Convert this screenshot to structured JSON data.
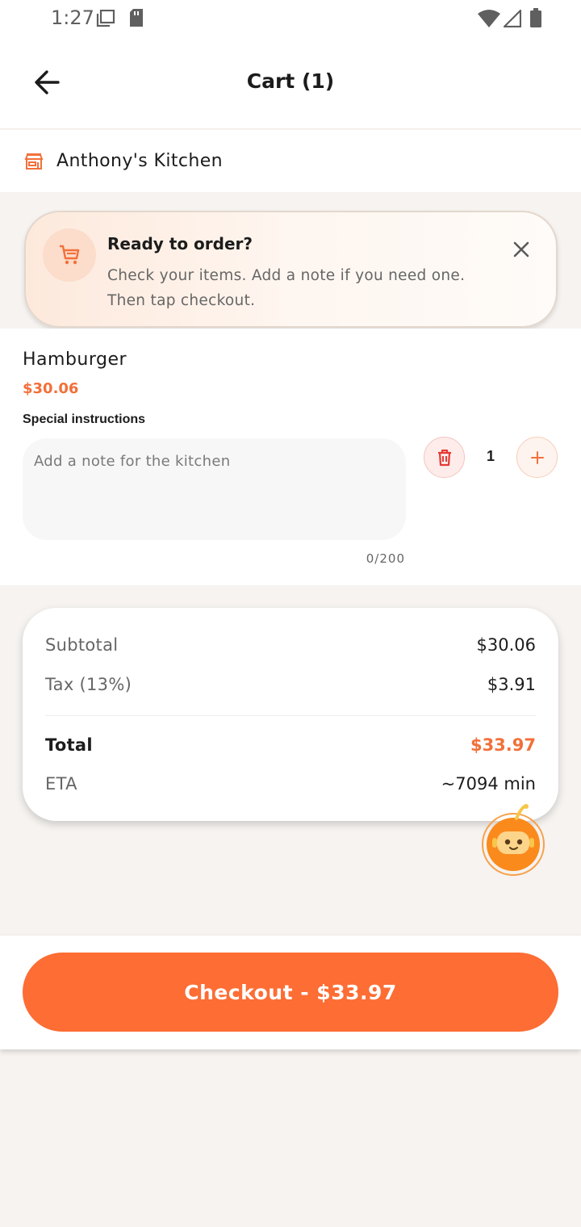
{
  "status_bar": {
    "time": "1:27"
  },
  "app_bar": {
    "title": "Cart (1)"
  },
  "restaurant": {
    "name": "Anthony's Kitchen"
  },
  "hint": {
    "title": "Ready to order?",
    "body": "Check your items. Add a note if you need one. Then tap checkout."
  },
  "item": {
    "name": "Hamburger",
    "price": "$30.06",
    "instructions_label": "Special instructions",
    "note_placeholder": "Add a note for the kitchen",
    "note_value": "",
    "char_count": "0/200",
    "quantity": "1"
  },
  "summary": {
    "subtotal_label": "Subtotal",
    "subtotal_value": "$30.06",
    "tax_label": "Tax (13%)",
    "tax_value": "$3.91",
    "total_label": "Total",
    "total_value": "$33.97",
    "eta_label": "ETA",
    "eta_value": "~7094 min"
  },
  "checkout": {
    "label": "Checkout - $33.97"
  },
  "icons": {
    "back": "arrow-left-icon",
    "store": "store-icon",
    "cart": "cart-icon",
    "close": "close-icon",
    "delete": "trash-icon",
    "plus": "plus-icon",
    "mascot": "robot-mascot-icon"
  },
  "colors": {
    "accent": "#fd6d34",
    "price": "#f2703a",
    "delete": "#e53935",
    "background": "#f6f3f0"
  }
}
